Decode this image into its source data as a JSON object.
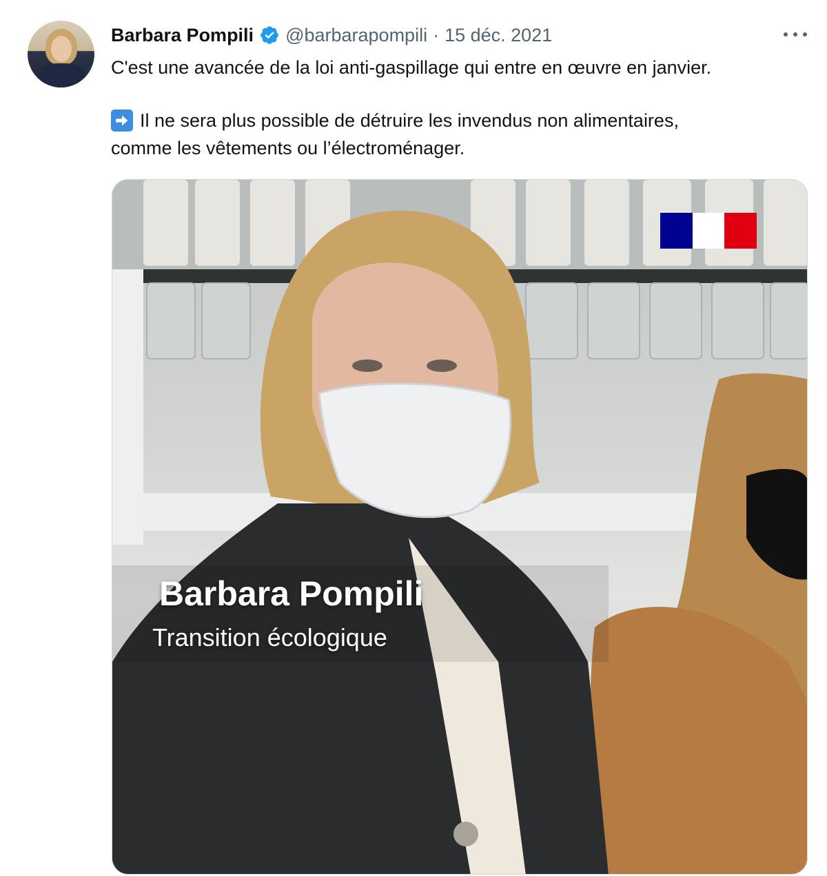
{
  "tweet": {
    "author_name": "Barbara Pompili",
    "handle": "@barbarapompili",
    "separator": "·",
    "date": "15 déc. 2021",
    "line1": "C'est une avancée de la loi anti-gaspillage qui entre en œuvre en janvier.",
    "line2": "Il ne sera plus possible de détruire les invendus non alimentaires,",
    "line3": "comme les vêtements ou l’électroménager."
  },
  "media": {
    "caption_name": "Barbara Pompili",
    "caption_role": "Transition écologique"
  },
  "icons": {
    "verified": "verified-badge-icon",
    "more": "more-options-icon",
    "arrow": "right-arrow-emoji",
    "logo": "republique-francaise-logo"
  },
  "colors": {
    "verified_blue": "#1d9bf0",
    "text_primary": "#0f1419",
    "text_secondary": "#536471",
    "emoji_blue": "#3d8ee0"
  }
}
